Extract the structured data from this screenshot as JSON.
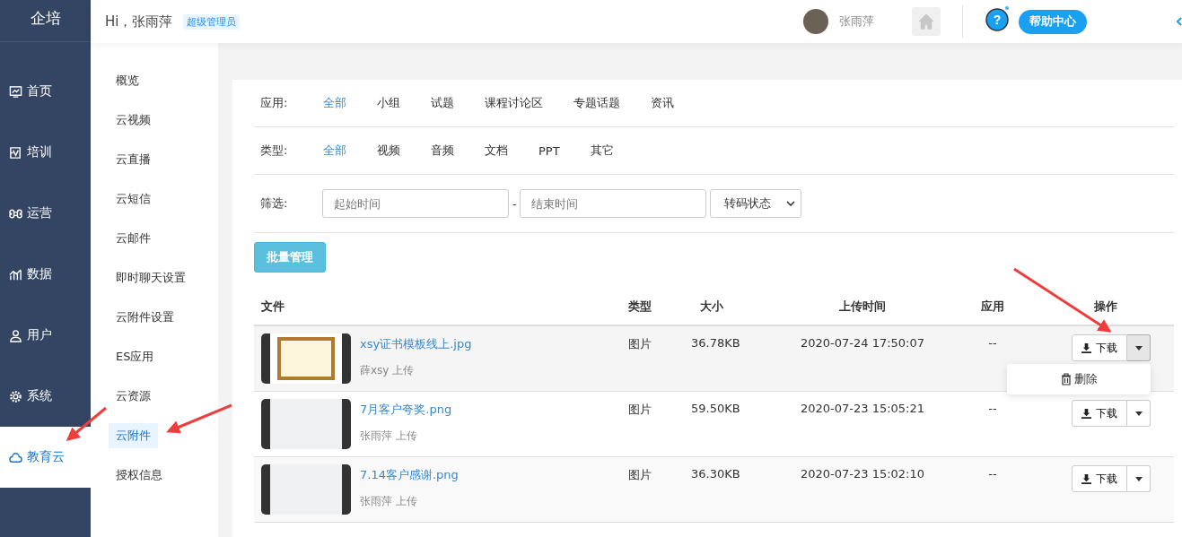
{
  "logo": "企培",
  "header": {
    "greeting": "Hi，张雨萍",
    "role_badge": "超级管理员",
    "user_name": "张雨萍",
    "help_icon": "?",
    "help_button": "帮助中心"
  },
  "sidebar": {
    "items": [
      {
        "label": "首页",
        "selected": false
      },
      {
        "label": "培训",
        "selected": false
      },
      {
        "label": "运营",
        "selected": false
      },
      {
        "label": "数据",
        "selected": false
      },
      {
        "label": "用户",
        "selected": false
      },
      {
        "label": "系统",
        "selected": false
      },
      {
        "label": "教育云",
        "selected": true
      }
    ]
  },
  "submenu": {
    "items": [
      {
        "label": "概览",
        "selected": false
      },
      {
        "label": "云视频",
        "selected": false
      },
      {
        "label": "云直播",
        "selected": false
      },
      {
        "label": "云短信",
        "selected": false
      },
      {
        "label": "云邮件",
        "selected": false
      },
      {
        "label": "即时聊天设置",
        "selected": false
      },
      {
        "label": "云附件设置",
        "selected": false
      },
      {
        "label": "ES应用",
        "selected": false
      },
      {
        "label": "云资源",
        "selected": false
      },
      {
        "label": "云附件",
        "selected": true
      },
      {
        "label": "授权信息",
        "selected": false
      }
    ]
  },
  "filters": {
    "app": {
      "label": "应用:",
      "options": [
        {
          "label": "全部",
          "selected": true
        },
        {
          "label": "小组",
          "selected": false
        },
        {
          "label": "试题",
          "selected": false
        },
        {
          "label": "课程讨论区",
          "selected": false
        },
        {
          "label": "专题话题",
          "selected": false
        },
        {
          "label": "资讯",
          "selected": false
        }
      ]
    },
    "type": {
      "label": "类型:",
      "options": [
        {
          "label": "全部",
          "selected": true
        },
        {
          "label": "视频",
          "selected": false
        },
        {
          "label": "音频",
          "selected": false
        },
        {
          "label": "文档",
          "selected": false
        },
        {
          "label": "PPT",
          "selected": false
        },
        {
          "label": "其它",
          "selected": false
        }
      ]
    },
    "screen": {
      "label": "筛选:",
      "start": {
        "placeholder": "起始时间"
      },
      "separator": "-",
      "end": {
        "placeholder": "结束时间"
      },
      "status": "转码状态"
    }
  },
  "batch_button": "批量管理",
  "table": {
    "columns": [
      "文件",
      "类型",
      "大小",
      "上传时间",
      "应用",
      "操作"
    ],
    "rows": [
      {
        "kind": "certificate",
        "name": "xsy证书模板线上.jpg",
        "uploader": "薛xsy 上传",
        "type": "图片",
        "size": "36.78KB",
        "time": "2020-07-24 17:50:07",
        "app": "--",
        "download": "下载",
        "menu_open": true,
        "menu_items": [
          "删除"
        ]
      },
      {
        "kind": "screenshot",
        "name": "7月客户夸奖.png",
        "uploader": "张雨萍 上传",
        "type": "图片",
        "size": "59.50KB",
        "time": "2020-07-23 15:05:21",
        "app": "--",
        "download": "下载",
        "menu_open": false
      },
      {
        "kind": "screenshot",
        "name": "7.14客户感谢.png",
        "uploader": "张雨萍 上传",
        "type": "图片",
        "size": "36.30KB",
        "time": "2020-07-23 15:02:10",
        "app": "--",
        "download": "下载",
        "menu_open": false
      }
    ]
  }
}
